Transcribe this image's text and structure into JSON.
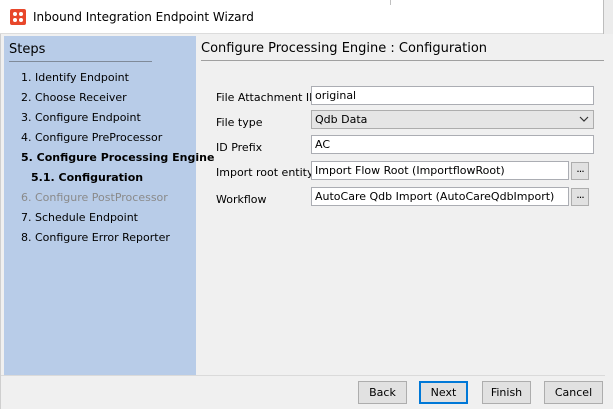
{
  "window": {
    "title": "Inbound Integration Endpoint Wizard"
  },
  "steps": {
    "heading": "Steps",
    "items": [
      {
        "label": "1. Identify Endpoint",
        "state": "normal"
      },
      {
        "label": "2. Choose Receiver",
        "state": "normal"
      },
      {
        "label": "3. Configure Endpoint",
        "state": "normal"
      },
      {
        "label": "4. Configure PreProcessor",
        "state": "normal"
      },
      {
        "label": "5. Configure Processing Engine",
        "state": "current"
      },
      {
        "label": "5.1. Configuration",
        "state": "current-sub"
      },
      {
        "label": "6. Configure PostProcessor",
        "state": "disabled"
      },
      {
        "label": "7. Schedule Endpoint",
        "state": "normal"
      },
      {
        "label": "8. Configure Error Reporter",
        "state": "normal"
      }
    ]
  },
  "main": {
    "heading": "Configure Processing Engine : Configuration",
    "fields": {
      "file_attachment_id": {
        "label": "File Attachment ID",
        "value": "original"
      },
      "file_type": {
        "label": "File type",
        "value": "Qdb Data"
      },
      "id_prefix": {
        "label": "ID Prefix",
        "value": "AC"
      },
      "import_root_entity": {
        "label": "Import root entity",
        "value": "Import Flow Root (ImportflowRoot)",
        "browse_label": "..."
      },
      "workflow": {
        "label": "Workflow",
        "value": "AutoCare Qdb Import (AutoCareQdbImport)",
        "browse_label": "..."
      }
    }
  },
  "footer": {
    "back_label": "Back",
    "next_label": "Next",
    "finish_label": "Finish",
    "cancel_label": "Cancel"
  },
  "icons": {
    "app": "app-logo-icon",
    "dropdown": "chevron-down-icon"
  },
  "colors": {
    "steps_panel": "#b8cce8",
    "app_icon": "#e8472b",
    "default_button_border": "#0078d7",
    "disabled_step": "#8a8a8a"
  }
}
